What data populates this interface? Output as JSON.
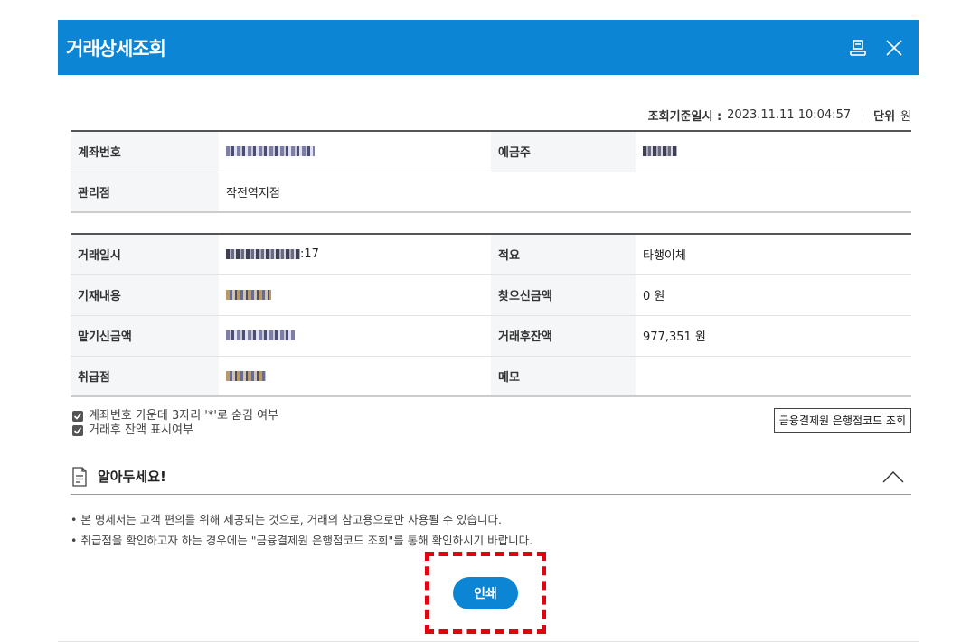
{
  "dialog": {
    "title": "거래상세조회",
    "print_icon": "printer-icon",
    "close_icon": "close-icon"
  },
  "meta": {
    "date_label": "조회기준일시 :",
    "date_value": "2023.11.11 10:04:57",
    "unit_label": "단위",
    "unit_value": "원"
  },
  "account_table": {
    "account_no_label": "계좌번호",
    "depositor_label": "예금주",
    "branch_label": "관리점",
    "branch_value": "작전역지점"
  },
  "transaction_table": {
    "datetime_label": "거래일시",
    "datetime_suffix": ":17",
    "summary_label": "적요",
    "summary_value": "타행이체",
    "memo_entry_label": "기재내용",
    "withdraw_label": "찾으신금액",
    "withdraw_value": "0 원",
    "deposit_label": "맡기신금액",
    "balance_label": "거래후잔액",
    "balance_value": "977,351 원",
    "handling_branch_label": "취급점",
    "memo_label": "메모",
    "memo_value": ""
  },
  "options": {
    "mask_account": "계좌번호 가운데 3자리 '*'로 숨김 여부",
    "show_balance": "거래후 잔액 표시여부",
    "bank_code_button": "금융결제원 은행점코드 조회"
  },
  "notice": {
    "title": "알아두세요!",
    "items": [
      "본 명세서는 고객 편의를 위해 제공되는 것으로, 거래의 참고용으로만 사용될 수 있습니다.",
      "취급점을 확인하고자 하는 경우에는 \"금융결제원 은행점코드 조회\"를 통해 확인하시기 바랍니다."
    ]
  },
  "actions": {
    "print_label": "인쇄"
  },
  "colors": {
    "brand": "#0c86d4",
    "highlight": "#e3000f"
  }
}
